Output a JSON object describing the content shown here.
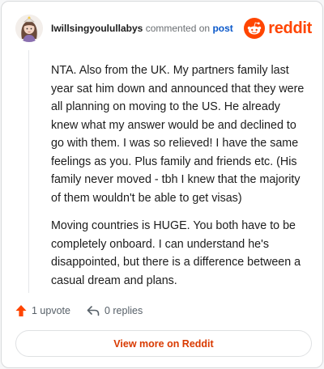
{
  "header": {
    "username": "Iwillsingyoulullabys",
    "action_text": "commented on",
    "post_link": "post",
    "logo_text": "reddit",
    "logo_icon": "reddit-snoo-icon",
    "avatar_icon": "avatar-icon"
  },
  "comment": {
    "paragraphs": [
      "NTA. Also from the UK. My partners family last year sat him down and announced that they were all planning on moving to the US. He already knew what my answer would be and declined to go with them. I was so relieved! I have the same feelings as you. Plus family and friends etc. (His family never moved - tbh I knew that the majority of them wouldn't be able to get visas)",
      "Moving countries is HUGE. You both have to be completely onboard. I can understand he's disappointed, but there is a difference between a casual dream and plans."
    ]
  },
  "actions": {
    "upvote_label": "1 upvote",
    "reply_label": "0 replies",
    "upvote_icon": "upvote-arrow-icon",
    "reply_icon": "reply-arrow-icon"
  },
  "view_more_label": "View more on Reddit",
  "colors": {
    "brand": "#ff4500",
    "link": "#0a58ca",
    "view_more": "#d93a00"
  }
}
